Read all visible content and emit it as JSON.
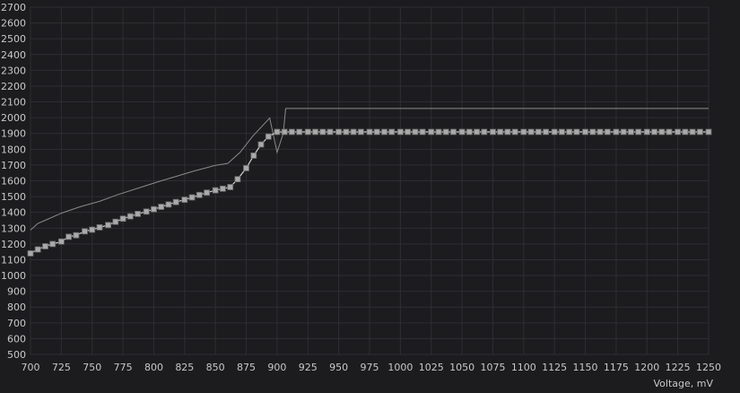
{
  "chart_data": {
    "type": "line",
    "xlabel": "Voltage, mV",
    "ylabel": "",
    "xlim": [
      700,
      1250
    ],
    "ylim": [
      500,
      2700
    ],
    "x_ticks": [
      700,
      725,
      750,
      775,
      800,
      825,
      850,
      875,
      900,
      925,
      950,
      975,
      1000,
      1025,
      1050,
      1075,
      1100,
      1125,
      1150,
      1175,
      1200,
      1225,
      1250
    ],
    "y_ticks": [
      500,
      600,
      700,
      800,
      900,
      1000,
      1100,
      1200,
      1300,
      1400,
      1500,
      1600,
      1700,
      1800,
      1900,
      2000,
      2100,
      2200,
      2300,
      2400,
      2500,
      2600,
      2700
    ],
    "grid": true,
    "colors": {
      "background": "#1c1c1f",
      "grid": "#2e2e33",
      "curve": "#d0d0d0",
      "points": "#a9a9a9",
      "reference": "#8a8a8a"
    },
    "series": [
      {
        "style": "thin-line",
        "x": [
          700,
          706,
          712,
          725,
          740,
          756,
          770,
          790,
          806,
          818,
          832,
          850,
          860,
          870,
          880,
          894,
          900,
          905,
          907,
          1250
        ],
        "y": [
          1288,
          1330,
          1350,
          1395,
          1435,
          1470,
          1510,
          1560,
          1600,
          1628,
          1660,
          1698,
          1710,
          1780,
          1880,
          1998,
          1780,
          1900,
          2058,
          2058
        ]
      },
      {
        "style": "line-with-square-markers",
        "x": [
          700,
          706,
          712,
          718,
          725,
          731,
          737,
          744,
          750,
          756,
          763,
          769,
          775,
          781,
          787,
          794,
          800,
          806,
          812,
          818,
          825,
          831,
          837,
          843,
          850,
          856,
          862,
          868,
          875,
          881,
          887,
          893,
          900,
          906,
          912,
          918,
          925,
          931,
          937,
          943,
          950,
          956,
          962,
          968,
          975,
          981,
          987,
          993,
          1000,
          1006,
          1012,
          1018,
          1025,
          1031,
          1037,
          1043,
          1050,
          1056,
          1062,
          1068,
          1075,
          1081,
          1087,
          1093,
          1100,
          1106,
          1112,
          1118,
          1125,
          1131,
          1137,
          1143,
          1150,
          1156,
          1162,
          1168,
          1175,
          1181,
          1187,
          1193,
          1200,
          1206,
          1212,
          1218,
          1225,
          1231,
          1237,
          1243,
          1250
        ],
        "y": [
          1140,
          1165,
          1185,
          1200,
          1215,
          1245,
          1255,
          1280,
          1290,
          1305,
          1320,
          1340,
          1360,
          1375,
          1390,
          1405,
          1420,
          1435,
          1450,
          1465,
          1480,
          1495,
          1510,
          1525,
          1540,
          1550,
          1560,
          1610,
          1680,
          1760,
          1830,
          1880,
          1910,
          1910,
          1910,
          1910,
          1910,
          1910,
          1910,
          1910,
          1910,
          1910,
          1910,
          1910,
          1910,
          1910,
          1910,
          1910,
          1910,
          1910,
          1910,
          1910,
          1910,
          1910,
          1910,
          1910,
          1910,
          1910,
          1910,
          1910,
          1910,
          1910,
          1910,
          1910,
          1910,
          1910,
          1910,
          1910,
          1910,
          1910,
          1910,
          1910,
          1910,
          1910,
          1910,
          1910,
          1910,
          1910,
          1910,
          1910,
          1910,
          1910,
          1910,
          1910,
          1910,
          1910,
          1910,
          1910,
          1910
        ]
      }
    ]
  }
}
